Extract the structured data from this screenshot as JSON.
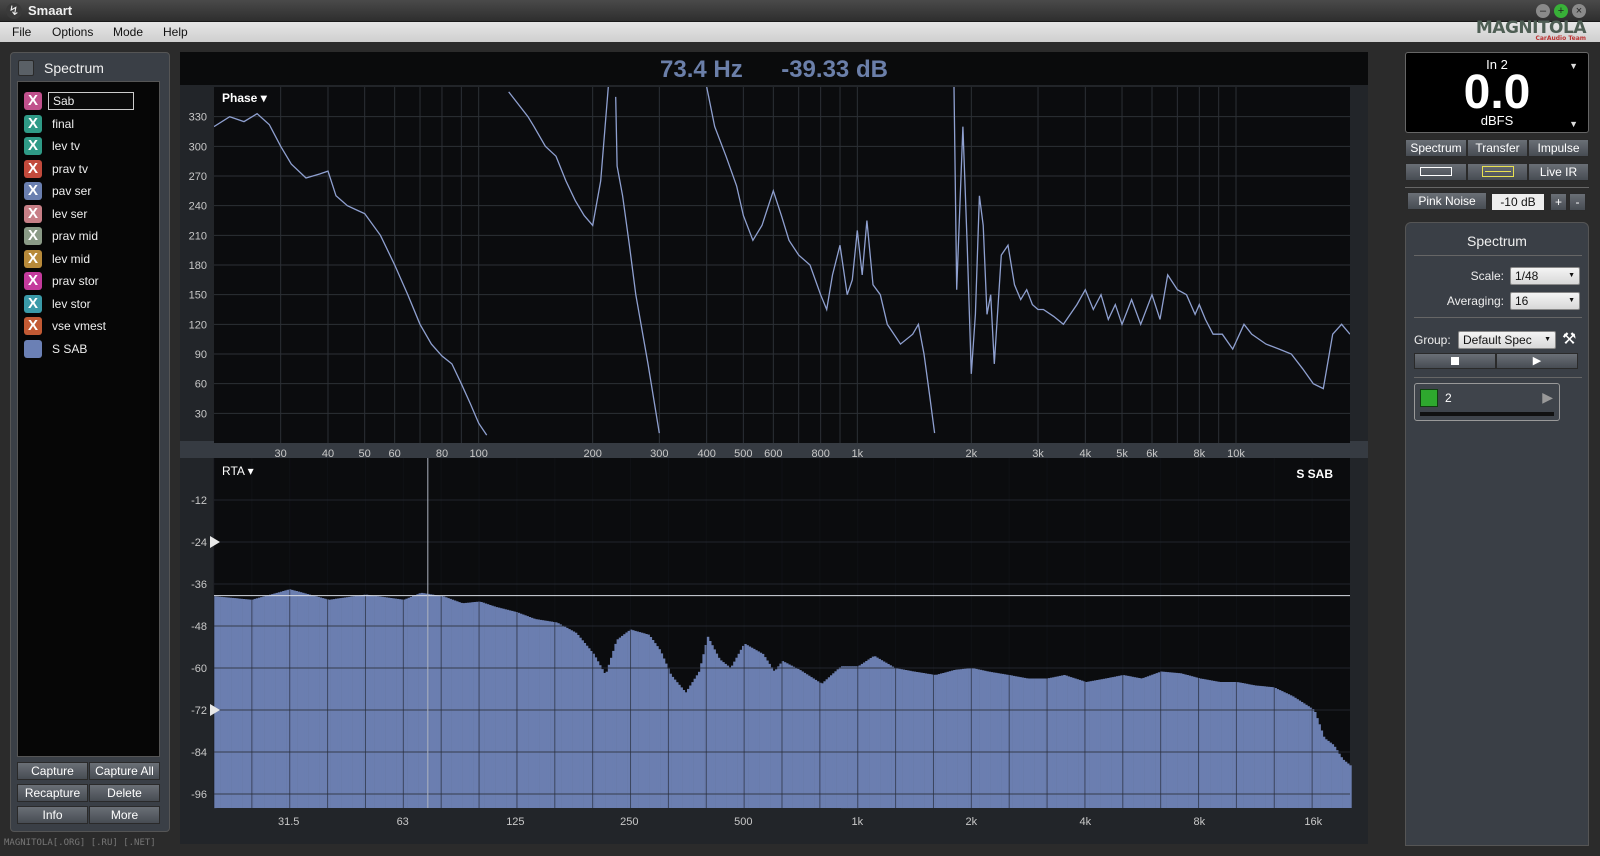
{
  "app": {
    "title": "Smaart"
  },
  "menu": [
    "File",
    "Options",
    "Mode",
    "Help"
  ],
  "logo": {
    "main": "MAGNITOLA",
    "sub": "CarAudio Team"
  },
  "watermark": "MAGNITOLA[.ORG] [.RU] [.NET]",
  "readout": {
    "freq": "73.4 Hz",
    "level": "-39.33 dB"
  },
  "left_panel": {
    "title": "Spectrum",
    "traces": [
      {
        "name": "Sab",
        "color": "#c0508c",
        "editing": true
      },
      {
        "name": "final",
        "color": "#2f9a86"
      },
      {
        "name": "lev tv",
        "color": "#2f9a86"
      },
      {
        "name": "prav tv",
        "color": "#c24a3c"
      },
      {
        "name": "pav ser",
        "color": "#6a7fb0"
      },
      {
        "name": "lev ser",
        "color": "#c77f86"
      },
      {
        "name": "prav mid",
        "color": "#8a9a86"
      },
      {
        "name": "lev mid",
        "color": "#b88a3a"
      },
      {
        "name": "prav stor",
        "color": "#c43a9c"
      },
      {
        "name": "lev stor",
        "color": "#3a9aa8"
      },
      {
        "name": "vse vmest",
        "color": "#c25a34"
      },
      {
        "name": "S SAB",
        "color": "#6b80b5",
        "solid": true
      }
    ],
    "buttons": [
      "Capture",
      "Capture All",
      "Recapture",
      "Delete",
      "Info",
      "More"
    ]
  },
  "phase_plot": {
    "mode_label": "Phase ▾",
    "y_ticks": [
      "330",
      "300",
      "270",
      "240",
      "210",
      "180",
      "150",
      "120",
      "90",
      "60",
      "30"
    ],
    "x_ticks": [
      "30",
      "40",
      "50",
      "60",
      "80",
      "100",
      "200",
      "300",
      "400",
      "500",
      "600",
      "800",
      "1k",
      "2k",
      "3k",
      "4k",
      "5k",
      "6k",
      "8k",
      "10k"
    ]
  },
  "rta_plot": {
    "mode_label": "RTA ▾",
    "trace_label": "S SAB",
    "y_ticks": [
      "-12",
      "-24",
      "-36",
      "-48",
      "-60",
      "-72",
      "-84",
      "-96"
    ],
    "x_ticks": [
      "31.5",
      "63",
      "125",
      "250",
      "500",
      "1k",
      "2k",
      "4k",
      "8k",
      "16k"
    ]
  },
  "chart_data": [
    {
      "type": "line",
      "title": "Phase",
      "x_scale": "log",
      "xlim": [
        20,
        20000
      ],
      "ylim": [
        0,
        360
      ],
      "series": [
        {
          "color": "#8fa0d0",
          "x": [
            20,
            22,
            24,
            26,
            28,
            30,
            32,
            35,
            38,
            40,
            42,
            45,
            48,
            50,
            55,
            60,
            65,
            70,
            75,
            80,
            85,
            90,
            95,
            100,
            105,
            110,
            115,
            120,
            135,
            140,
            150,
            160,
            170,
            180,
            190,
            200,
            210,
            220,
            225,
            230,
            232,
            240,
            250,
            260,
            280,
            300,
            320,
            340,
            360,
            380,
            400,
            420,
            450,
            480,
            500,
            530,
            560,
            600,
            630,
            660,
            700,
            750,
            800,
            830,
            860,
            900,
            940,
            970,
            1000,
            1030,
            1060,
            1100,
            1150,
            1200,
            1300,
            1400,
            1450,
            1500,
            1550,
            1600,
            1700,
            1800,
            1830,
            1900,
            1950,
            2000,
            2050,
            2100,
            2150,
            2200,
            2250,
            2300,
            2400,
            2500,
            2600,
            2700,
            2800,
            2900,
            3000,
            3100,
            3300,
            3500,
            3800,
            4000,
            4200,
            4400,
            4600,
            4800,
            5000,
            5300,
            5600,
            6000,
            6300,
            6600,
            7000,
            7400,
            7800,
            8000,
            8300,
            8700,
            9200,
            9800,
            10500,
            11000,
            12000,
            13000,
            14000,
            15000,
            16000,
            17000,
            18000,
            19000,
            20000
          ],
          "y": [
            320,
            330,
            325,
            333,
            322,
            300,
            282,
            268,
            272,
            275,
            250,
            240,
            235,
            232,
            210,
            180,
            150,
            120,
            100,
            88,
            80,
            60,
            40,
            20,
            8,
            null,
            null,
            355,
            330,
            320,
            300,
            290,
            265,
            245,
            230,
            220,
            265,
            360,
            null,
            350,
            280,
            250,
            200,
            150,
            80,
            10,
            null,
            null,
            null,
            null,
            360,
            320,
            290,
            260,
            230,
            205,
            220,
            255,
            230,
            205,
            190,
            180,
            150,
            135,
            170,
            200,
            150,
            165,
            215,
            170,
            225,
            160,
            150,
            120,
            100,
            110,
            120,
            90,
            50,
            10,
            null,
            360,
            155,
            320,
            200,
            70,
            130,
            250,
            220,
            130,
            150,
            80,
            190,
            200,
            160,
            145,
            155,
            140,
            135,
            135,
            128,
            120,
            140,
            155,
            135,
            150,
            125,
            140,
            120,
            145,
            120,
            150,
            125,
            170,
            155,
            150,
            130,
            140,
            125,
            110,
            110,
            95,
            120,
            110,
            100,
            95,
            90,
            75,
            60,
            55,
            110,
            120,
            110
          ]
        }
      ]
    },
    {
      "type": "area",
      "title": "RTA",
      "x_scale": "log",
      "xlim": [
        20,
        20000
      ],
      "ylim": [
        -100,
        0
      ],
      "series": [
        {
          "name": "S SAB",
          "color": "#6b7eb0",
          "x": [
            20,
            25,
            31.5,
            40,
            50,
            63,
            70,
            80,
            90,
            100,
            110,
            125,
            140,
            160,
            180,
            200,
            215,
            230,
            250,
            280,
            300,
            320,
            350,
            380,
            400,
            430,
            460,
            500,
            560,
            600,
            630,
            700,
            800,
            900,
            1000,
            1100,
            1250,
            1400,
            1600,
            1800,
            2000,
            2200,
            2500,
            2800,
            3150,
            3500,
            4000,
            4500,
            5000,
            5600,
            6300,
            7100,
            8000,
            9000,
            10000,
            11200,
            12500,
            14000,
            16000,
            17000,
            18000,
            19000,
            20000
          ],
          "y": [
            -39.5,
            -40.5,
            -37.5,
            -40.5,
            -39.0,
            -40.5,
            -38.5,
            -39.5,
            -41.5,
            -41.0,
            -42.5,
            -44.0,
            -46.0,
            -47.0,
            -50.0,
            -56.0,
            -62.0,
            -52.0,
            -49.0,
            -50.5,
            -55.0,
            -62.0,
            -67.0,
            -61.0,
            -51.0,
            -57.5,
            -60.0,
            -53.0,
            -56.0,
            -61.0,
            -58.0,
            -60.5,
            -64.5,
            -59.5,
            -59.5,
            -56.5,
            -60.0,
            -61.0,
            -62.0,
            -60.5,
            -60.0,
            -61.0,
            -62.0,
            -63.0,
            -63.0,
            -62.0,
            -64.0,
            -63.0,
            -62.0,
            -63.0,
            -61.0,
            -61.5,
            -63.0,
            -64.0,
            -64.0,
            -65.0,
            -65.5,
            -68.0,
            -72.0,
            -80.0,
            -82.0,
            -86.0,
            -88.0
          ]
        }
      ],
      "cursor_x": 73.4,
      "threshold_db": -39.33,
      "markers_db": [
        -24,
        -72
      ]
    }
  ],
  "right_panel": {
    "meter": {
      "channel": "In 2",
      "value": "0.0",
      "unit": "dBFS"
    },
    "mode_tabs": [
      "Spectrum",
      "Transfer",
      "Impulse"
    ],
    "live_ir": "Live IR",
    "pink_noise": "Pink Noise",
    "noise_level": "-10 dB",
    "plus": "+",
    "minus": "-",
    "section_title": "Spectrum",
    "scale_label": "Scale:",
    "scale_value": "1/48",
    "averaging_label": "Averaging:",
    "averaging_value": "16",
    "group_label": "Group:",
    "group_value": "Default Spec",
    "engine_label": "2",
    "colors": {
      "run": "#2ea82e"
    }
  }
}
